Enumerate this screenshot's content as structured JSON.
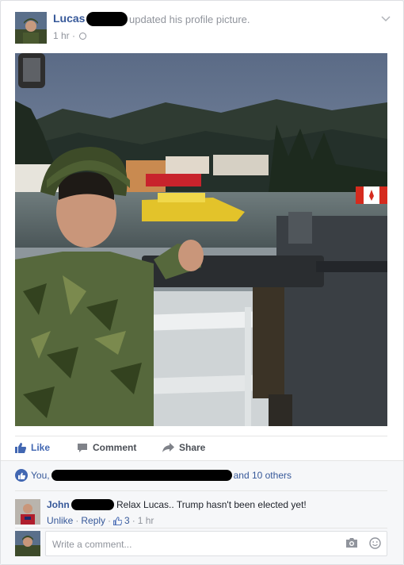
{
  "post": {
    "author_name": "Lucas",
    "action_text": "updated his profile picture.",
    "timestamp": "1 hr",
    "separator": "·",
    "privacy_icon": "globe-icon",
    "menu_icon": "chevron-down-icon"
  },
  "actions": {
    "like_label": "Like",
    "comment_label": "Comment",
    "share_label": "Share"
  },
  "likes": {
    "prefix": "You,",
    "suffix": "and 10 others"
  },
  "comment": {
    "author": "John",
    "text": "Relax Lucas.. Trump hasn't been elected yet!",
    "unlike_label": "Unlike",
    "reply_label": "Reply",
    "like_count": "3",
    "timestamp": "1 hr"
  },
  "composer": {
    "placeholder": "Write a comment...",
    "camera_icon": "camera-icon",
    "emoji_icon": "emoji-icon"
  },
  "colors": {
    "link": "#365899",
    "like_blue": "#4267b2",
    "meta_gray": "#90949c"
  }
}
